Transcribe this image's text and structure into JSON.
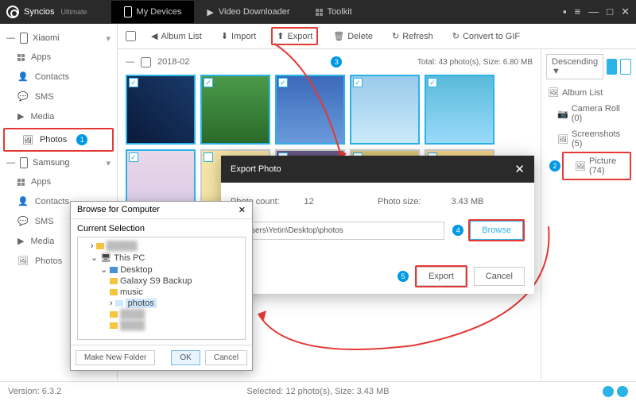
{
  "app": {
    "name": "Syncios",
    "edition": "Ultimate"
  },
  "header_tabs": {
    "devices": "My Devices",
    "video": "Video Downloader",
    "toolkit": "Toolkit"
  },
  "devices": [
    {
      "name": "Xiaomi",
      "items": [
        "Apps",
        "Contacts",
        "SMS",
        "Media",
        "Photos"
      ],
      "selected": 4
    },
    {
      "name": "Samsung",
      "items": [
        "Apps",
        "Contacts",
        "SMS",
        "Media",
        "Photos"
      ]
    }
  ],
  "toolbar": {
    "album": "Album List",
    "import": "Import",
    "export": "Export",
    "delete": "Delete",
    "refresh": "Refresh",
    "gif": "Convert to GIF"
  },
  "sort": {
    "label": "Descending",
    "mode": "▼"
  },
  "group": {
    "date": "2018-02",
    "summary": "Total: 43 photo(s), Size: 6.80 MB"
  },
  "right": {
    "album": "Album List",
    "camera": "Camera Roll (0)",
    "screenshots": "Screenshots (5)",
    "picture": "Picture (74)"
  },
  "export_dialog": {
    "title": "Export Photo",
    "count_label": "Photo count:",
    "count": "12",
    "size_label": "Photo size:",
    "size": "3.43 MB",
    "path": "C:\\Users\\Yetin\\Desktop\\photos",
    "browse": "Browse",
    "export": "Export",
    "cancel": "Cancel"
  },
  "browse_dialog": {
    "title": "Browse for Computer",
    "current": "Current Selection",
    "nodes": {
      "pc": "This PC",
      "desktop": "Desktop",
      "backup": "Galaxy S9 Backup",
      "music": "music",
      "photos": "photos"
    },
    "make": "Make New Folder",
    "ok": "OK",
    "cancel": "Cancel"
  },
  "footer": {
    "version": "Version: 6.3.2",
    "selected": "Selected: 12 photo(s), Size: 3.43 MB"
  },
  "badges": {
    "b1": "1",
    "b2": "2",
    "b3": "3",
    "b4": "4",
    "b5": "5"
  }
}
